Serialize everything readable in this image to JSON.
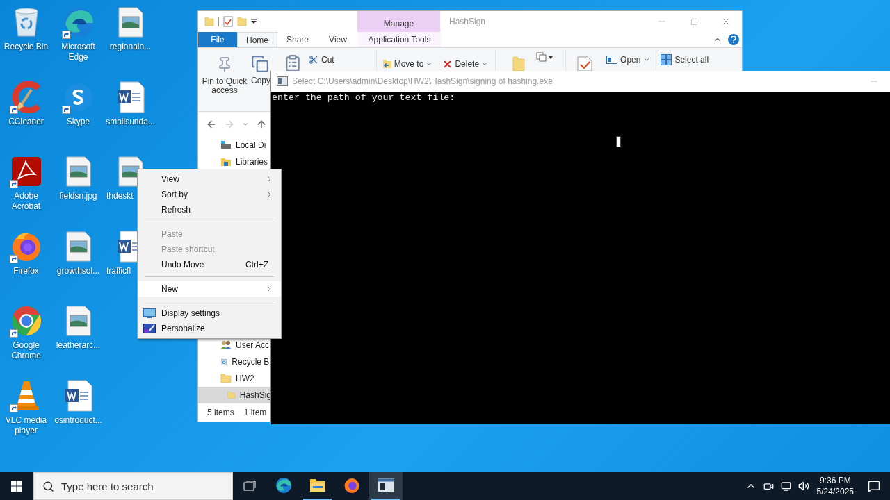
{
  "desktop_icons": [
    {
      "label": "Recycle Bin",
      "kind": "recycle",
      "shortcut": false,
      "covered": false
    },
    {
      "label": "CCleaner",
      "kind": "ccleaner",
      "shortcut": true,
      "covered": false
    },
    {
      "label": "Adobe Acrobat",
      "kind": "acrobat",
      "shortcut": true,
      "covered": false
    },
    {
      "label": "Firefox",
      "kind": "firefox",
      "shortcut": true,
      "covered": false
    },
    {
      "label": "Google Chrome",
      "kind": "chrome",
      "shortcut": true,
      "covered": false
    },
    {
      "label": "VLC media player",
      "kind": "vlc",
      "shortcut": true,
      "covered": false
    },
    {
      "label": "Microsoft Edge",
      "kind": "edge",
      "shortcut": true,
      "covered": false
    },
    {
      "label": "Skype",
      "kind": "skype",
      "shortcut": true,
      "covered": false
    },
    {
      "label": "fieldsn.jpg",
      "kind": "image",
      "shortcut": false,
      "covered": false
    },
    {
      "label": "growthsol...",
      "kind": "image",
      "shortcut": false,
      "covered": false
    },
    {
      "label": "leatherarc...",
      "kind": "image",
      "shortcut": false,
      "covered": false
    },
    {
      "label": "osintroduct...",
      "kind": "document",
      "shortcut": false,
      "covered": false
    },
    {
      "label": "regionaln...",
      "kind": "image",
      "shortcut": false,
      "covered": false
    },
    {
      "label": "smallsunda...",
      "kind": "document",
      "shortcut": false,
      "covered": false
    },
    {
      "label": "thdeskt",
      "kind": "image",
      "shortcut": false,
      "covered": true
    },
    {
      "label": "trafficfl",
      "kind": "document",
      "shortcut": false,
      "covered": true
    }
  ],
  "explorer": {
    "title": "HashSign",
    "contextual_tab": "Manage",
    "tabs": [
      {
        "label": "File",
        "kind": "menu",
        "selected": false
      },
      {
        "label": "Home",
        "kind": "tab",
        "selected": true
      },
      {
        "label": "Share",
        "kind": "tab",
        "selected": false
      },
      {
        "label": "View",
        "kind": "tab",
        "selected": false
      },
      {
        "label": "Application Tools",
        "kind": "contextual",
        "selected": false
      }
    ],
    "ribbon": {
      "pin": "Pin to Quick access",
      "copy": "Copy",
      "cut": "Cut",
      "move_to": "Move to",
      "delete": "Delete",
      "open": "Open",
      "select_all": "Select all"
    },
    "nav_items": [
      {
        "label": "Local Di",
        "kind": "drive",
        "selected": false
      },
      {
        "label": "Libraries",
        "kind": "libraries",
        "selected": false
      },
      {
        "label": "User Acc",
        "kind": "users",
        "selected": false
      },
      {
        "label": "Recycle Bi",
        "kind": "recycle",
        "selected": false
      },
      {
        "label": "HW2",
        "kind": "folder",
        "selected": false,
        "children": [
          {
            "label": "HashSig",
            "kind": "folder",
            "selected": true
          }
        ]
      }
    ],
    "status_bar": [
      "5 items",
      "1 item"
    ]
  },
  "console": {
    "title": "Select C:\\Users\\admin\\Desktop\\HW2\\HashSign\\signing of hashing.exe",
    "output": "enter the path of your text file:"
  },
  "context_menu": {
    "items": [
      {
        "label": "View",
        "kind": "submenu",
        "disabled": false,
        "selected": false
      },
      {
        "label": "Sort by",
        "kind": "submenu",
        "disabled": false,
        "selected": false
      },
      {
        "label": "Refresh",
        "kind": "command",
        "disabled": false,
        "selected": false
      },
      {
        "kind": "separator"
      },
      {
        "label": "Paste",
        "kind": "command",
        "disabled": true,
        "selected": false
      },
      {
        "label": "Paste shortcut",
        "kind": "command",
        "disabled": true,
        "selected": false
      },
      {
        "label": "Undo Move",
        "kind": "command",
        "disabled": false,
        "selected": false,
        "shortcut": "Ctrl+Z"
      },
      {
        "kind": "separator"
      },
      {
        "label": "New",
        "kind": "submenu",
        "disabled": false,
        "selected": true
      },
      {
        "kind": "separator"
      },
      {
        "label": "Display settings",
        "kind": "icon_command",
        "disabled": false,
        "selected": false
      },
      {
        "label": "Personalize",
        "kind": "icon_command",
        "disabled": false,
        "selected": false
      }
    ]
  },
  "taskbar": {
    "search_placeholder": "Type here to search",
    "apps": [
      {
        "running": false,
        "selected": false
      },
      {
        "running": true,
        "selected": false
      },
      {
        "running": false,
        "selected": false
      },
      {
        "running": true,
        "selected": true
      }
    ],
    "time": "9:36 PM",
    "date": "5/24/2025"
  }
}
